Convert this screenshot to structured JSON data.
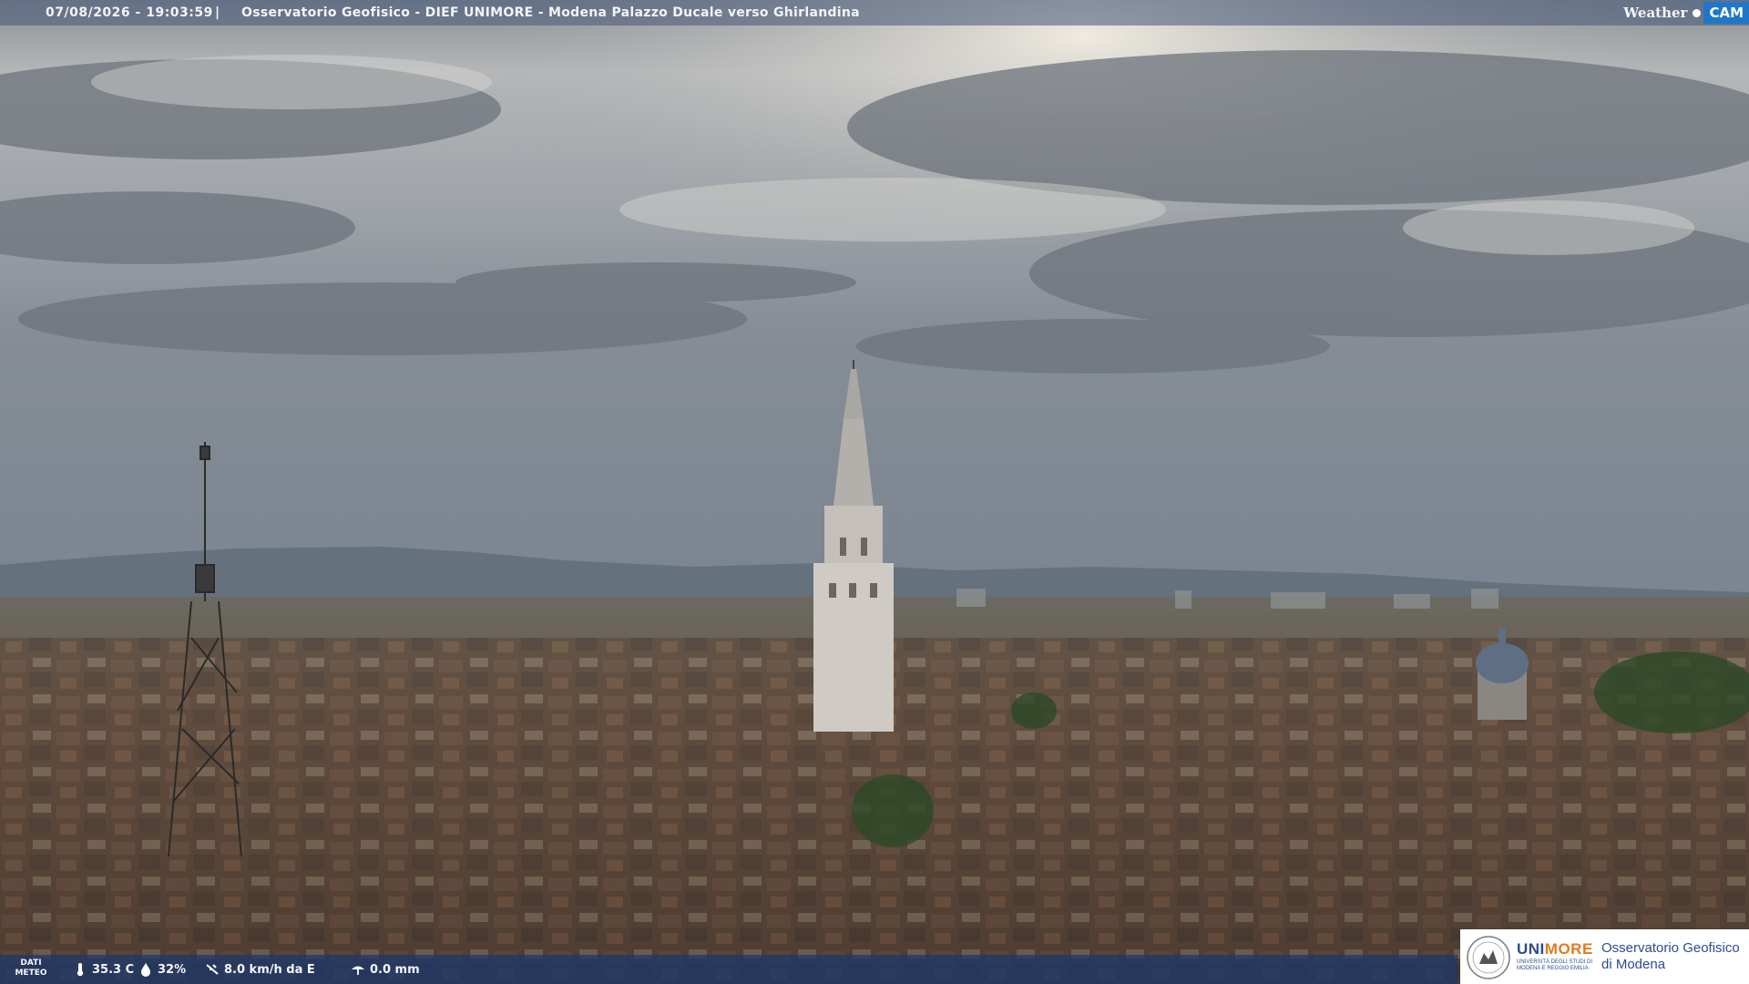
{
  "header": {
    "timestamp": "07/08/2026 - 19:03:59",
    "separator": "|",
    "caption": "Osservatorio Geofisico - DIEF UNIMORE - Modena Palazzo Ducale verso Ghirlandina",
    "brand_weather": "Weather",
    "brand_cam": "CAM"
  },
  "weather": {
    "label_line1": "DATI",
    "label_line2": "METEO",
    "temperature": "35.3 C",
    "humidity": "32%",
    "wind": "8.0 km/h da E",
    "rain": "0.0 mm"
  },
  "logo": {
    "name_main": "UNI",
    "name_accent": "MORE",
    "subtitle": "UNIVERSITÀ DEGLI STUDI DI MODENA E REGGIO EMILIA",
    "right_line1": "Osservatorio Geofisico",
    "right_line2": "di Modena"
  },
  "colors": {
    "overlay_bar": "#46587a",
    "bottom_bar": "#19376e",
    "brand_blue": "#1f77c9",
    "unimore_blue": "#2b4c8c",
    "unimore_orange": "#e07a1f"
  },
  "icons": [
    "thermometer-icon",
    "humidity-drop-icon",
    "wind-icon",
    "rain-gauge-icon",
    "unimore-seal-icon"
  ]
}
